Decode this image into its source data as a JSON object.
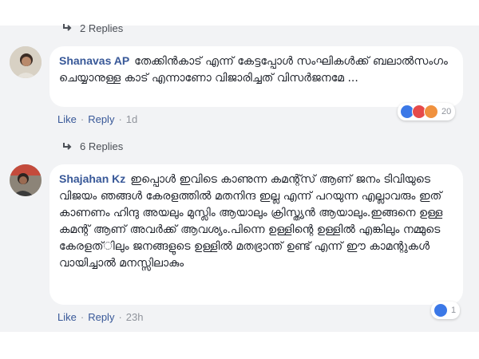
{
  "thread_top": {
    "replies_label": "2 Replies"
  },
  "comment1": {
    "author": "Shanavas AP",
    "text": "തേക്കിൻകാട് എന്ന് കേട്ടപ്പോൾ സംഘികൾക്ക് ബലാൽസംഗം ചെയ്യാനുള്ള കാട് എന്നാണോ വിജാരിച്ചത് വിസർജനമേ ...",
    "like_label": "Like",
    "reply_label": "Reply",
    "time": "1d",
    "reaction_count": "20",
    "reaction_icons": [
      "like-icon",
      "love-icon",
      "angry-icon"
    ],
    "replies_label": "6 Replies"
  },
  "comment2": {
    "author": "Shajahan Kz",
    "text": "ഇപ്പൊൾ ഇവിടെ കാണുന്ന കമന്റ്സ് ആണ് ജനം ടിവിയുടെ വിജയം ഞങ്ങൾ കേരളത്തിൽ മതനിന്ദ ഇല്ല എന്ന് പറയുന്ന എല്ലാവരും ഇത് കാണണം ഹിന്ദു അയലും മുസ്ലിം ആയാലും ക്രിസ്ത്യൻ ആയാലും.ഇങ്ങനെ ഉള്ള കമന്റ് ആണ് അവർക്ക് ആവശ്യം.പിന്നെ ഉള്ളിന്റെ ഉള്ളിൽ എങ്കിലും നമ്മുടെ കേരളത്ിലും ജനങ്ങളുടെ ഉള്ളിൽ മതഭ്രാന്ത് ഉണ്ട് എന്ന് ഈ കാമന്റുകൾ വായിച്ചാൽ മനസ്സിലാകും",
    "like_label": "Like",
    "reply_label": "Reply",
    "time": "23h",
    "reaction_count": "1",
    "reaction_icons": [
      "like-icon"
    ]
  },
  "colors": {
    "link": "#385898",
    "meta_gray": "#90949c",
    "panel_bg": "#f2f3f5",
    "bubble_bg": "#ffffff",
    "like_blue": "#3b78e7",
    "love_red": "#e64a4a",
    "angry_orange": "#f0913e"
  }
}
